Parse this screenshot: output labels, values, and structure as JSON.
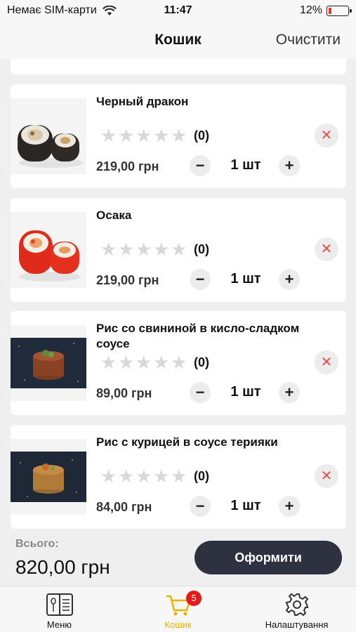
{
  "status_bar": {
    "carrier": "Немає SIM-карти",
    "time": "11:47",
    "battery": "12%",
    "battery_level": 0.12,
    "battery_color": "#e33333"
  },
  "header": {
    "title": "Кошик",
    "clear_label": "Очистити"
  },
  "cart": {
    "items": [
      {
        "name": "Черный дракон",
        "rating_count": "(0)",
        "price": "219,00 грн",
        "quantity": "1 шт",
        "image": "sushi-roll-dark"
      },
      {
        "name": "Осака",
        "rating_count": "(0)",
        "price": "219,00 грн",
        "quantity": "1 шт",
        "image": "sushi-roll-red"
      },
      {
        "name": " Рис со свининой в кисло-сладком соусе",
        "rating_count": "(0)",
        "price": "89,00 грн",
        "quantity": "1 шт",
        "image": "rice-pork"
      },
      {
        "name": "Рис с курицей в соусе терияки",
        "rating_count": "(0)",
        "price": "84,00 грн",
        "quantity": "1 шт",
        "image": "rice-chicken"
      }
    ],
    "minus_symbol": "−",
    "plus_symbol": "+",
    "remove_symbol": "✕",
    "star_symbol": "★"
  },
  "footer": {
    "total_label": "Всього:",
    "total_value": "820,00 грн",
    "checkout_label": "Оформити"
  },
  "tabbar": {
    "items": [
      {
        "label": "Меню",
        "icon": "menu-book-icon"
      },
      {
        "label": "Кошик",
        "icon": "cart-icon",
        "badge": "5"
      },
      {
        "label": "Налаштування",
        "icon": "gear-icon"
      }
    ],
    "active_color": "#e9b200"
  }
}
